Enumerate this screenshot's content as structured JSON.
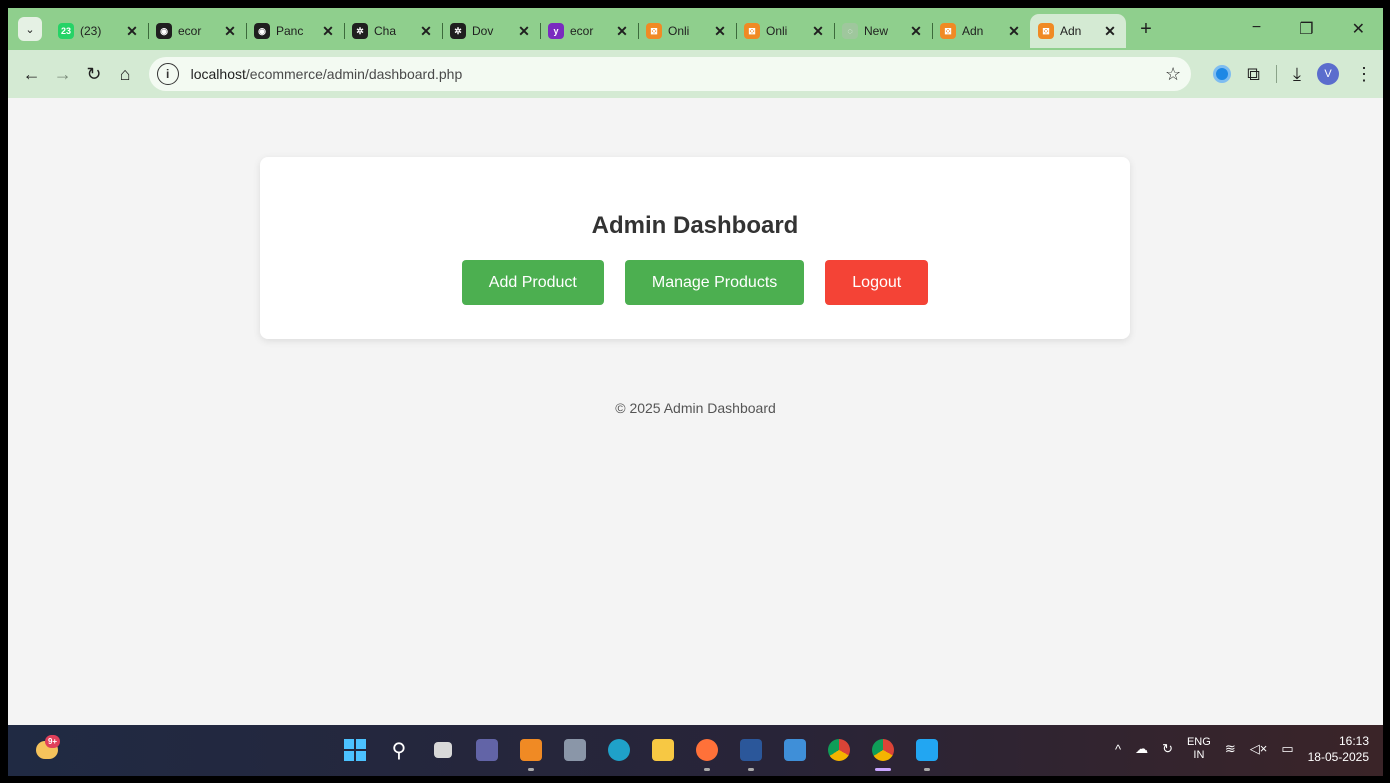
{
  "browser": {
    "tabs": [
      {
        "title": "(23)",
        "fav_color": "#25d366",
        "fav_glyph": "23"
      },
      {
        "title": "ecor",
        "fav_color": "#1f1f1f",
        "fav_glyph": "◉"
      },
      {
        "title": "Panc",
        "fav_color": "#1f1f1f",
        "fav_glyph": "◉"
      },
      {
        "title": "Cha",
        "fav_color": "#1f1f1f",
        "fav_glyph": "✲"
      },
      {
        "title": "Dov",
        "fav_color": "#1f1f1f",
        "fav_glyph": "✲"
      },
      {
        "title": "ecor",
        "fav_color": "#7a2bbf",
        "fav_glyph": "y"
      },
      {
        "title": "Onli",
        "fav_color": "#f08a24",
        "fav_glyph": "⊠"
      },
      {
        "title": "Onli",
        "fav_color": "#f08a24",
        "fav_glyph": "⊠"
      },
      {
        "title": "New",
        "fav_color": "#9fc79d",
        "fav_glyph": "◌"
      },
      {
        "title": "Adn",
        "fav_color": "#f08a24",
        "fav_glyph": "⊠"
      },
      {
        "title": "Adn",
        "fav_color": "#f08a24",
        "fav_glyph": "⊠",
        "active": true
      }
    ],
    "close_glyph": "✕",
    "new_tab_glyph": "+",
    "window_controls": {
      "minimize": "−",
      "restore": "❐",
      "close": "✕"
    },
    "url_host": "localhost",
    "url_path": "/ecommerce/admin/dashboard.php",
    "profile_initial": "V"
  },
  "page": {
    "title": "Admin Dashboard",
    "buttons": {
      "add_product": "Add Product",
      "manage_products": "Manage Products",
      "logout": "Logout"
    },
    "footer": "© 2025 Admin Dashboard"
  },
  "taskbar": {
    "weather_badge": "9+",
    "lang_line1": "ENG",
    "lang_line2": "IN",
    "time": "16:13",
    "date": "18-05-2025"
  },
  "colors": {
    "tabstrip": "#8fcf8d",
    "toolbar": "#d4ead3",
    "button_green": "#4caf50",
    "button_red": "#f44336"
  }
}
